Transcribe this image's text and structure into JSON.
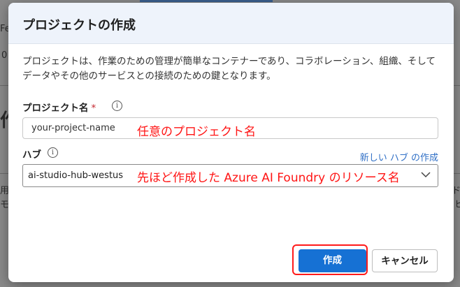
{
  "background": {
    "fragments": [
      "Fe",
      "0",
      "作",
      "用",
      "モ",
      "ド",
      "ヒ"
    ]
  },
  "dialog": {
    "title": "プロジェクトの作成",
    "description": "プロジェクトは、作業のための管理が簡単なコンテナーであり、コラボレーション、組織、そしてデータやその他のサービスとの接続のための鍵となります。",
    "project_name": {
      "label": "プロジェクト名",
      "required_mark": "*",
      "value": "your-project-name",
      "annotation": "任意のプロジェクト名"
    },
    "hub": {
      "label": "ハブ",
      "new_hub_link": "新しい ハブ の作成",
      "selected": "ai-studio-hub-westus",
      "annotation": "先ほど作成した Azure AI Foundry のリソース名"
    },
    "buttons": {
      "create": "作成",
      "cancel": "キャンセル"
    }
  }
}
